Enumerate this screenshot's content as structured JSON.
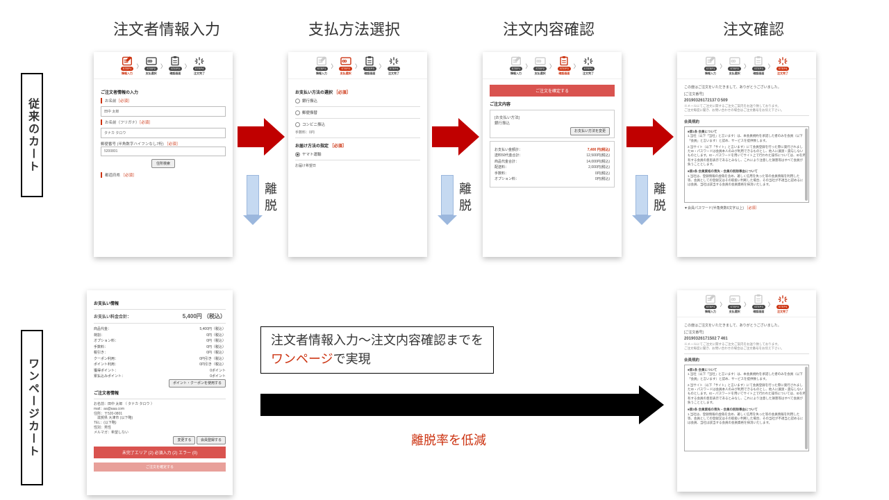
{
  "top_titles": [
    "注文者情報入力",
    "支払方法選択",
    "注文内容確認",
    "注文確認"
  ],
  "row_labels": {
    "classic": "従来のカート",
    "onepage": "ワンページカート"
  },
  "steps": {
    "tags": [
      "STEP1",
      "STEP2",
      "STEP3",
      "STEP4"
    ],
    "labels": [
      "情報入力",
      "支払選択",
      "確認画面",
      "注文完了"
    ]
  },
  "ridatsu_label": "離脱",
  "message_a": "注文者情報入力～注文内容確認までを",
  "message_b_red": "ワンページ",
  "message_b_plain": "で実現",
  "ridatsu_teigen": "離脱率を低減",
  "card1": {
    "sec": "ご注文者情報の入力",
    "name_lbl": "お名前",
    "req": "［必須］",
    "name_val": "田中 太郎",
    "kana_lbl": "お名前（フリガナ）",
    "kana_val": "タナカ タロウ",
    "zip_lbl": "郵便番号 (半角数字ハイフンなし7桁)",
    "zip_val": "5200801",
    "search_btn": "住所検索",
    "pref_lbl": "都道府県"
  },
  "card2": {
    "sec": "お支払い方法の選択",
    "opts": [
      "銀行振込",
      "郵便振替",
      "コンビニ振込"
    ],
    "fee": "手数料：0円",
    "deliv_sec": "お届け方法の指定",
    "deliv_opt": "ヤマト運輸",
    "deliv_date": "お届け希望日"
  },
  "card3": {
    "confirm_btn": "ご注文を確定する",
    "sec": "ご注文内容",
    "pay_title": "[お支払い方法]",
    "pay_val": "銀行振込",
    "change_btn": "お支払い方法を変更",
    "sum_items": [
      {
        "k": "お支払い金額計：",
        "v": "7,400 円(税込)",
        "strong": true
      },
      {
        "k": "送料50代金合計：",
        "v": "12,500円(税込)"
      },
      {
        "k": "商品代金合計：",
        "v": "14,000円(税込)"
      },
      {
        "k": "配送料：",
        "v": "2,000円(税込)"
      },
      {
        "k": "手数料：",
        "v": "0円(税込)"
      },
      {
        "k": "オプション料：",
        "v": "0円(税込)"
      }
    ]
  },
  "card4": {
    "thanks": "この度はご注文をいただきまして、ありがとうございました。",
    "order_no_lbl": "[ご注文番号]",
    "order_no": "20190326172137０509",
    "mail_note": "※メールにてご注文に関するご注文ご案内をお送り致しております。",
    "note2": "ご注文毎度に聞き、お問い合わせの場合はご注文番号をお伝え下さい。",
    "terms_title": "会員規約",
    "t_h1": "■第1条 会員について",
    "t_l1": "1.当社（以下「当社」と言います）は、本会員規約を承諾した者のみを会員（以下「会員」と言います）と認め、サービスを提供致します。",
    "t_l2": "2.当サイト（以下「サイト」と言います）にて会員登録を行った際に発行されましたID・パスワードは会員本人のみが利用できるものとし、他人に譲渡・貸与しないものとします。ID・パスワードを用いてサイト上で行われた操作については、IDを所有する会員の意思表示であるとみなし、これにより注意した損害等はすべて会員が負うこととします。",
    "t_h2": "■第2条 会員資格の喪失・会員の削除事由について",
    "t_l3": "1.当社は、登録情報の虚偽を含め、著しく信用を失った等の会員情報を利用した等、会員としての登録又はその取扱い判断した場合、その当社が不適当と認めるには会員、当社は該当する会員の会員資格を抹消いたします。",
    "pw_label": "会員パスワード(半角英数6文字以上)"
  },
  "one_card": {
    "sec_pay": "お支払い情報",
    "total_lbl": "お支払い料金合計：",
    "total_val": "5,400円 （税込）",
    "lines": [
      {
        "k": "商品代金：",
        "v": "5,400円（税込）"
      },
      {
        "k": "荷割：",
        "v": "0円（税込）"
      },
      {
        "k": "オプション料：",
        "v": "0円（税込）"
      },
      {
        "k": "手数料：",
        "v": "0円（税込）"
      },
      {
        "k": "税引き：",
        "v": "0円（税込）"
      },
      {
        "k": "クーポン利用：",
        "v": "0円引き（税込）"
      },
      {
        "k": "ポイント利用：",
        "v": "0円引き（税込）"
      },
      {
        "k": "獲得ポイント：",
        "v": "0ポイント"
      },
      {
        "k": "累払込みポイント：",
        "v": "0ポイント"
      }
    ],
    "coupon_btn": "ポイント・クーポンを使用する",
    "sec_cust": "ご注文者情報",
    "cust": [
      "お名前：田中 太郎 （ タナカ タロウ ）",
      "mail：aa@aaa.com",
      "住所：〒520-0801",
      "　滋賀県 大津市 (以下略)",
      "TEL：(以下略)",
      "性別：男性",
      "メルマガ：希望しない"
    ],
    "btn_change": "変更する",
    "btn_reg": "会員登録する",
    "err": "未完了エリア (2) 必須入力 (2) エラー (0)",
    "submit": "ご注文を確定する"
  },
  "one_done": {
    "order_no": "20190326171502７461"
  }
}
